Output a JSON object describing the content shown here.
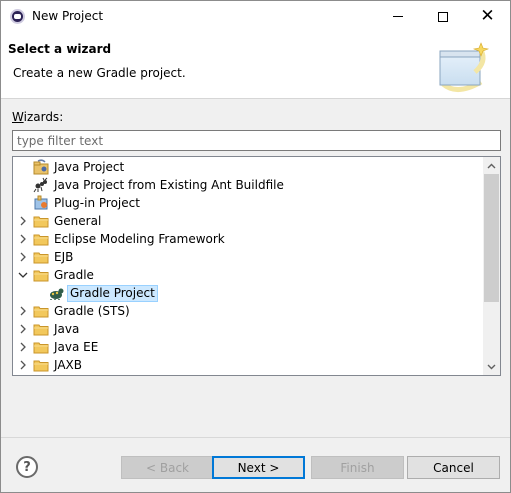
{
  "window": {
    "title": "New Project"
  },
  "banner": {
    "title": "Select a wizard",
    "description": "Create a new Gradle project."
  },
  "wizards": {
    "label_prefix": "W",
    "label_rest": "izards:",
    "filter_placeholder": "type filter text",
    "tree": [
      {
        "label": "Java Project",
        "icon": "java-project-icon",
        "twisty": "none",
        "depth": 0
      },
      {
        "label": "Java Project from Existing Ant Buildfile",
        "icon": "ant-icon",
        "twisty": "none",
        "depth": 0
      },
      {
        "label": "Plug-in Project",
        "icon": "plugin-project-icon",
        "twisty": "none",
        "depth": 0
      },
      {
        "label": "General",
        "icon": "folder-icon",
        "twisty": "collapsed",
        "depth": 0
      },
      {
        "label": "Eclipse Modeling Framework",
        "icon": "folder-icon",
        "twisty": "collapsed",
        "depth": 0
      },
      {
        "label": "EJB",
        "icon": "folder-icon",
        "twisty": "collapsed",
        "depth": 0
      },
      {
        "label": "Gradle",
        "icon": "folder-icon",
        "twisty": "expanded",
        "depth": 0
      },
      {
        "label": "Gradle Project",
        "icon": "gradle-icon",
        "twisty": "none",
        "depth": 1,
        "selected": true
      },
      {
        "label": "Gradle (STS)",
        "icon": "folder-icon",
        "twisty": "collapsed",
        "depth": 0
      },
      {
        "label": "Java",
        "icon": "folder-icon",
        "twisty": "collapsed",
        "depth": 0
      },
      {
        "label": "Java EE",
        "icon": "folder-icon",
        "twisty": "collapsed",
        "depth": 0
      },
      {
        "label": "JAXB",
        "icon": "folder-icon",
        "twisty": "collapsed",
        "depth": 0
      }
    ]
  },
  "buttons": {
    "back": "< Back",
    "next": "Next >",
    "finish": "Finish",
    "cancel": "Cancel",
    "help": "?"
  },
  "colors": {
    "selection_bg": "#cce8ff",
    "default_button_border": "#0078d7",
    "folder": "#e8b84a"
  }
}
